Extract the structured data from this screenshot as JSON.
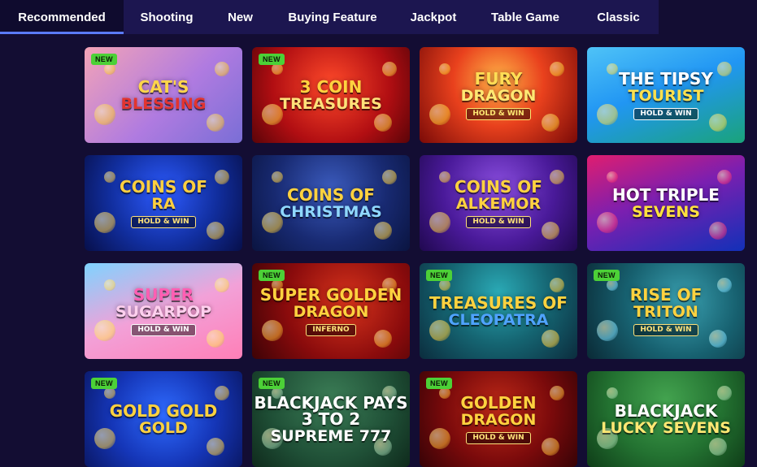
{
  "tabs": [
    {
      "label": "Recommended",
      "active": true,
      "w": 152
    },
    {
      "label": "Shooting",
      "active": false,
      "w": 106
    },
    {
      "label": "New",
      "active": false,
      "w": 75
    },
    {
      "label": "Buying Feature",
      "active": false,
      "w": 152
    },
    {
      "label": "Jackpot",
      "active": false,
      "w": 96
    },
    {
      "label": "Table Game",
      "active": false,
      "w": 130
    },
    {
      "label": "Classic",
      "active": false,
      "w": 99
    }
  ],
  "games": [
    {
      "new": true,
      "t1": "Cat's",
      "t2": "Blessing",
      "t3": "",
      "bg": "linear-gradient(135deg,#f3a3b7,#b07be0 55%,#7a6ed6)",
      "c1": "#ffd54a",
      "c2": "#e3342f",
      "c3": "#ffffff",
      "deco": "#ffcc33"
    },
    {
      "new": true,
      "t1": "3 Coin",
      "t2": "Treasures",
      "t3": "",
      "bg": "radial-gradient(circle at 50% 40%,#ff4a2a,#b10e12 60%,#5a0408)",
      "c1": "#ffd23f",
      "c2": "#ffe27a",
      "c3": "#ffffff",
      "deco": "#ffd23f"
    },
    {
      "new": false,
      "t1": "Fury",
      "t2": "Dragon",
      "t3": "Hold & Win",
      "bg": "radial-gradient(circle at 50% 35%,#ffb347,#e9411d 45%,#7a0a07)",
      "c1": "#ffdd55",
      "c2": "#ffe873",
      "c3": "#ffe873",
      "deco": "#ffcc33"
    },
    {
      "new": false,
      "t1": "The Tipsy",
      "t2": "Tourist",
      "t3": "Hold & Win",
      "bg": "linear-gradient(160deg,#4fc3f7,#2196f3 45%,#1aa37a)",
      "c1": "#ffffff",
      "c2": "#ffe14d",
      "c3": "#ffffff",
      "deco": "#ffe14d"
    },
    {
      "new": false,
      "t1": "Coins of",
      "t2": "Ra",
      "t3": "Hold & Win",
      "bg": "radial-gradient(circle at 50% 40%,#2d5bff,#112e9e 55%,#070f4a)",
      "c1": "#ffcf3f",
      "c2": "#ffcf3f",
      "c3": "#ffe27a",
      "deco": "#ffcf3f"
    },
    {
      "new": false,
      "t1": "Coins of",
      "t2": "Christmas",
      "t3": "",
      "bg": "radial-gradient(circle at 50% 35%,#3b5bbd,#182a72 55%,#0a1440)",
      "c1": "#ffd23f",
      "c2": "#8fd8ff",
      "c3": "#ffffff",
      "deco": "#ffd23f"
    },
    {
      "new": false,
      "t1": "Coins of",
      "t2": "Alkemor",
      "t3": "Hold & Win",
      "bg": "radial-gradient(circle at 50% 35%,#8b4fe0,#4a1a9a 55%,#20084f)",
      "c1": "#ffd23f",
      "c2": "#ffd23f",
      "c3": "#ffe27a",
      "deco": "#ffd23f"
    },
    {
      "new": false,
      "t1": "Hot Triple",
      "t2": "Sevens",
      "t3": "",
      "bg": "linear-gradient(160deg,#e01d6f,#7b1fb0 45%,#1230b8)",
      "c1": "#ffffff",
      "c2": "#ffe23d",
      "c3": "#ffffff",
      "deco": "#ff3c7e"
    },
    {
      "new": false,
      "t1": "Super",
      "t2": "Sugarpop",
      "t3": "Hold & Win",
      "bg": "linear-gradient(160deg,#7fd3ff,#f2a1d8 50%,#ff7fb7)",
      "c1": "#ff5fb3",
      "c2": "#ffd0ee",
      "c3": "#ffffff",
      "deco": "#ffe15a"
    },
    {
      "new": true,
      "t1": "Super Golden",
      "t2": "Dragon",
      "t3": "Inferno",
      "bg": "radial-gradient(circle at 60% 40%,#d8341c,#8a0b0c 55%,#3d0306)",
      "c1": "#ffd23f",
      "c2": "#ffd23f",
      "c3": "#ffe27a",
      "deco": "#ffb833"
    },
    {
      "new": true,
      "t1": "Treasures of",
      "t2": "Cleopatra",
      "t3": "",
      "bg": "radial-gradient(circle at 50% 30%,#2aa9b5,#156572 50%,#0b2c3d)",
      "c1": "#ffd23f",
      "c2": "#4fa3ff",
      "c3": "#ffffff",
      "deco": "#ffd23f"
    },
    {
      "new": true,
      "t1": "Rise of",
      "t2": "Triton",
      "t3": "Hold & Win",
      "bg": "radial-gradient(circle at 60% 40%,#3aa0b0,#176170 50%,#0a2a36)",
      "c1": "#ffd23f",
      "c2": "#ffd23f",
      "c3": "#ffe27a",
      "deco": "#7de0ff"
    },
    {
      "new": true,
      "t1": "Gold Gold",
      "t2": "Gold",
      "t3": "",
      "bg": "radial-gradient(circle at 50% 45%,#2f6bff,#1536b8 55%,#0a1866)",
      "c1": "#ffd23f",
      "c2": "#ffd23f",
      "c3": "#ffffff",
      "deco": "#ffd23f"
    },
    {
      "new": true,
      "t1": "Blackjack pays 3 to 2",
      "t2": "Supreme 777",
      "t3": "",
      "bg": "radial-gradient(circle at 50% 30%,#3b7d56,#1f4f36 60%,#0f2a1c)",
      "c1": "#ffffff",
      "c2": "#ffffff",
      "c3": "#ffffff",
      "deco": "#9fd3ad"
    },
    {
      "new": true,
      "t1": "Golden",
      "t2": "Dragon",
      "t3": "Hold & Win",
      "bg": "radial-gradient(circle at 50% 40%,#c02a18,#7a0a0b 55%,#360306)",
      "c1": "#ffd23f",
      "c2": "#ffd23f",
      "c3": "#ffe27a",
      "deco": "#ffb833"
    },
    {
      "new": false,
      "t1": "Blackjack",
      "t2": "Lucky Sevens",
      "t3": "",
      "bg": "radial-gradient(circle at 50% 30%,#43a34f,#237231 55%,#0f3d18)",
      "c1": "#ffffff",
      "c2": "#ffe873",
      "c3": "#ffffff",
      "deco": "#b4e6b8"
    }
  ],
  "badge_label": "NEW"
}
